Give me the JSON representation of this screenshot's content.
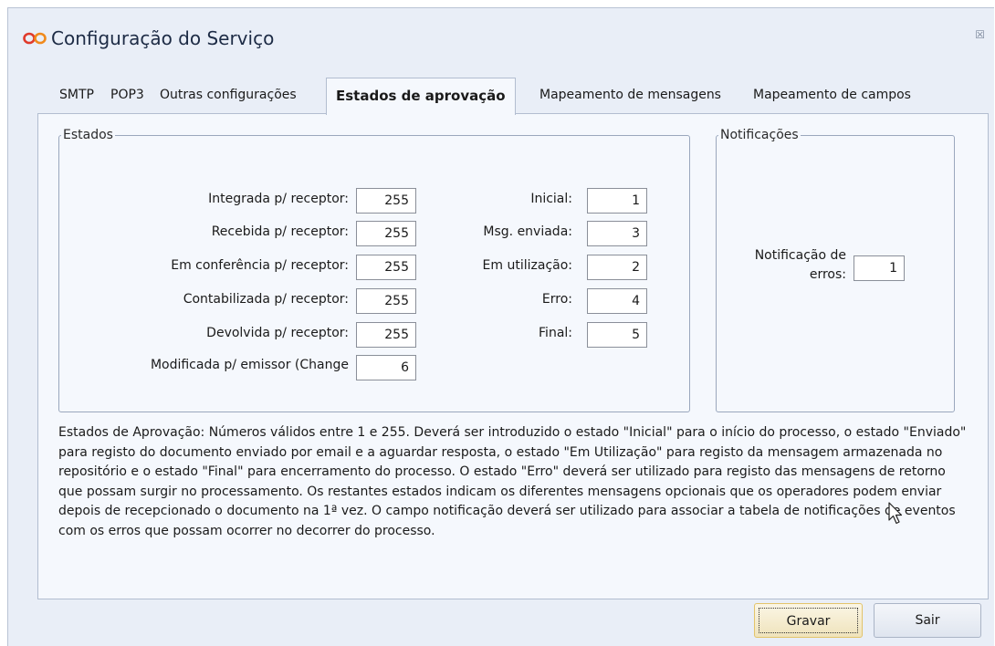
{
  "window": {
    "title": "Configuração do Serviço",
    "icon": "infinity-logo-icon",
    "close_symbol": "☒"
  },
  "tabs": [
    {
      "label": "SMTP",
      "active": false
    },
    {
      "label": "POP3",
      "active": false
    },
    {
      "label": "Outras configurações",
      "active": false
    },
    {
      "label": "Estados de aprovação",
      "active": true
    },
    {
      "label": "Mapeamento de mensagens",
      "active": false
    },
    {
      "label": "Mapeamento de campos",
      "active": false
    }
  ],
  "estados": {
    "legend": "Estados",
    "left": [
      {
        "label": "Integrada p/ receptor:",
        "value": "255"
      },
      {
        "label": "Recebida p/ receptor:",
        "value": "255"
      },
      {
        "label": "Em conferência p/ receptor:",
        "value": "255"
      },
      {
        "label": "Contabilizada p/ receptor:",
        "value": "255"
      },
      {
        "label": "Devolvida p/ receptor:",
        "value": "255"
      },
      {
        "label": "Modificada p/ emissor (Change",
        "value": "6"
      }
    ],
    "right": [
      {
        "label": "Inicial:",
        "value": "1"
      },
      {
        "label": "Msg. enviada:",
        "value": "3"
      },
      {
        "label": "Em utilização:",
        "value": "2"
      },
      {
        "label": "Erro:",
        "value": "4"
      },
      {
        "label": "Final:",
        "value": "5"
      }
    ]
  },
  "notificacoes": {
    "legend": "Notificações",
    "label_line1": "Notificação de",
    "label_line2": "erros:",
    "value": "1"
  },
  "description": "Estados de Aprovação: Números válidos entre 1 e 255. Deverá ser introduzido o estado \"Inicial\" para o início do processo, o estado \"Enviado\" para registo do documento enviado por email e a aguardar resposta, o estado \"Em Utilização\" para registo da mensagem armazenada no repositório e o estado \"Final\" para encerramento do processo. O estado \"Erro\" deverá ser utilizado para registo das mensagens de retorno que possam surgir no processamento. Os restantes estados indicam os diferentes mensagens opcionais que os operadores podem enviar depois de recepcionado o documento na 1ª vez. O campo notificação deverá ser utilizado para associar a tabela de notificações de eventos com os erros que possam ocorrer no decorrer do processo.",
  "buttons": {
    "save": "Gravar",
    "exit": "Sair"
  },
  "colors": {
    "window_bg": "#e9eef7",
    "panel_bg": "#f5f8fd",
    "logo_orange": "#f08a1c",
    "logo_red": "#e03a2b",
    "default_button_border": "#e3c46a"
  }
}
